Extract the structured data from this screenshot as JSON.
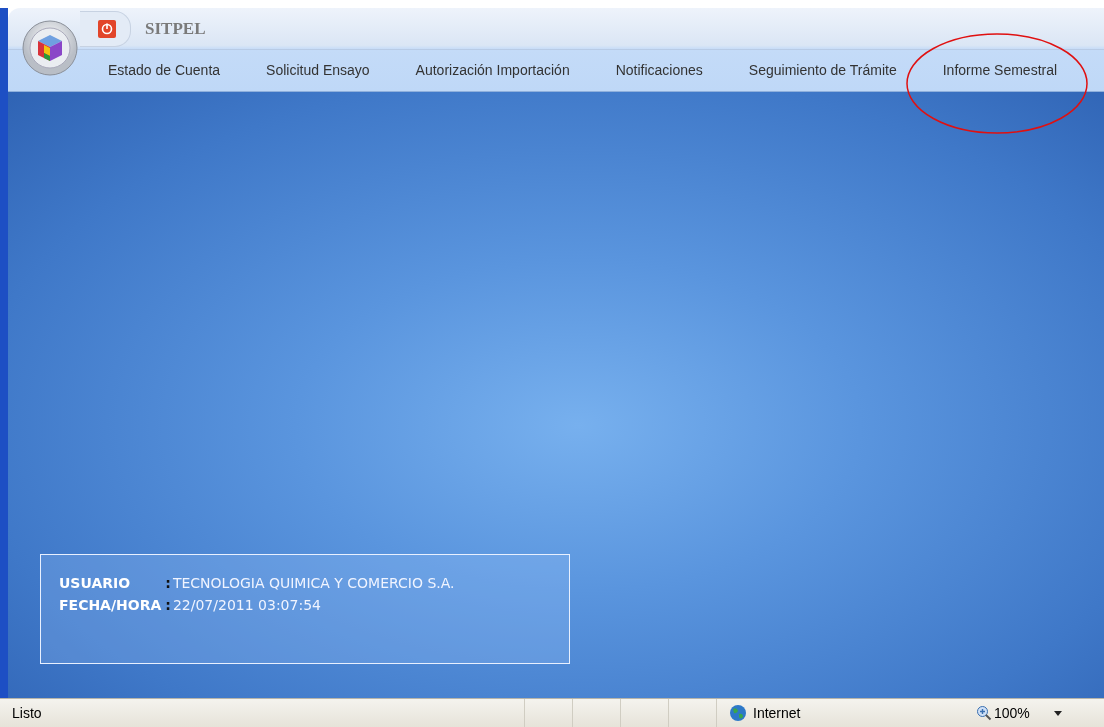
{
  "app": {
    "title": "SITPEL"
  },
  "menu": [
    {
      "label": "Estado de Cuenta"
    },
    {
      "label": "Solicitud Ensayo"
    },
    {
      "label": "Autorización Importación"
    },
    {
      "label": "Notificaciones"
    },
    {
      "label": "Seguimiento de Trámite"
    },
    {
      "label": "Informe Semestral"
    }
  ],
  "session": [
    {
      "label": "USUARIO",
      "separator": ":",
      "value": "TECNOLOGIA QUIMICA Y COMERCIO S.A."
    },
    {
      "label": "FECHA/HORA",
      "separator": ":",
      "value": "22/07/2011 03:07:54"
    }
  ],
  "status_bar": {
    "status": "Listo",
    "zone": "Internet",
    "zoom": "100%"
  }
}
